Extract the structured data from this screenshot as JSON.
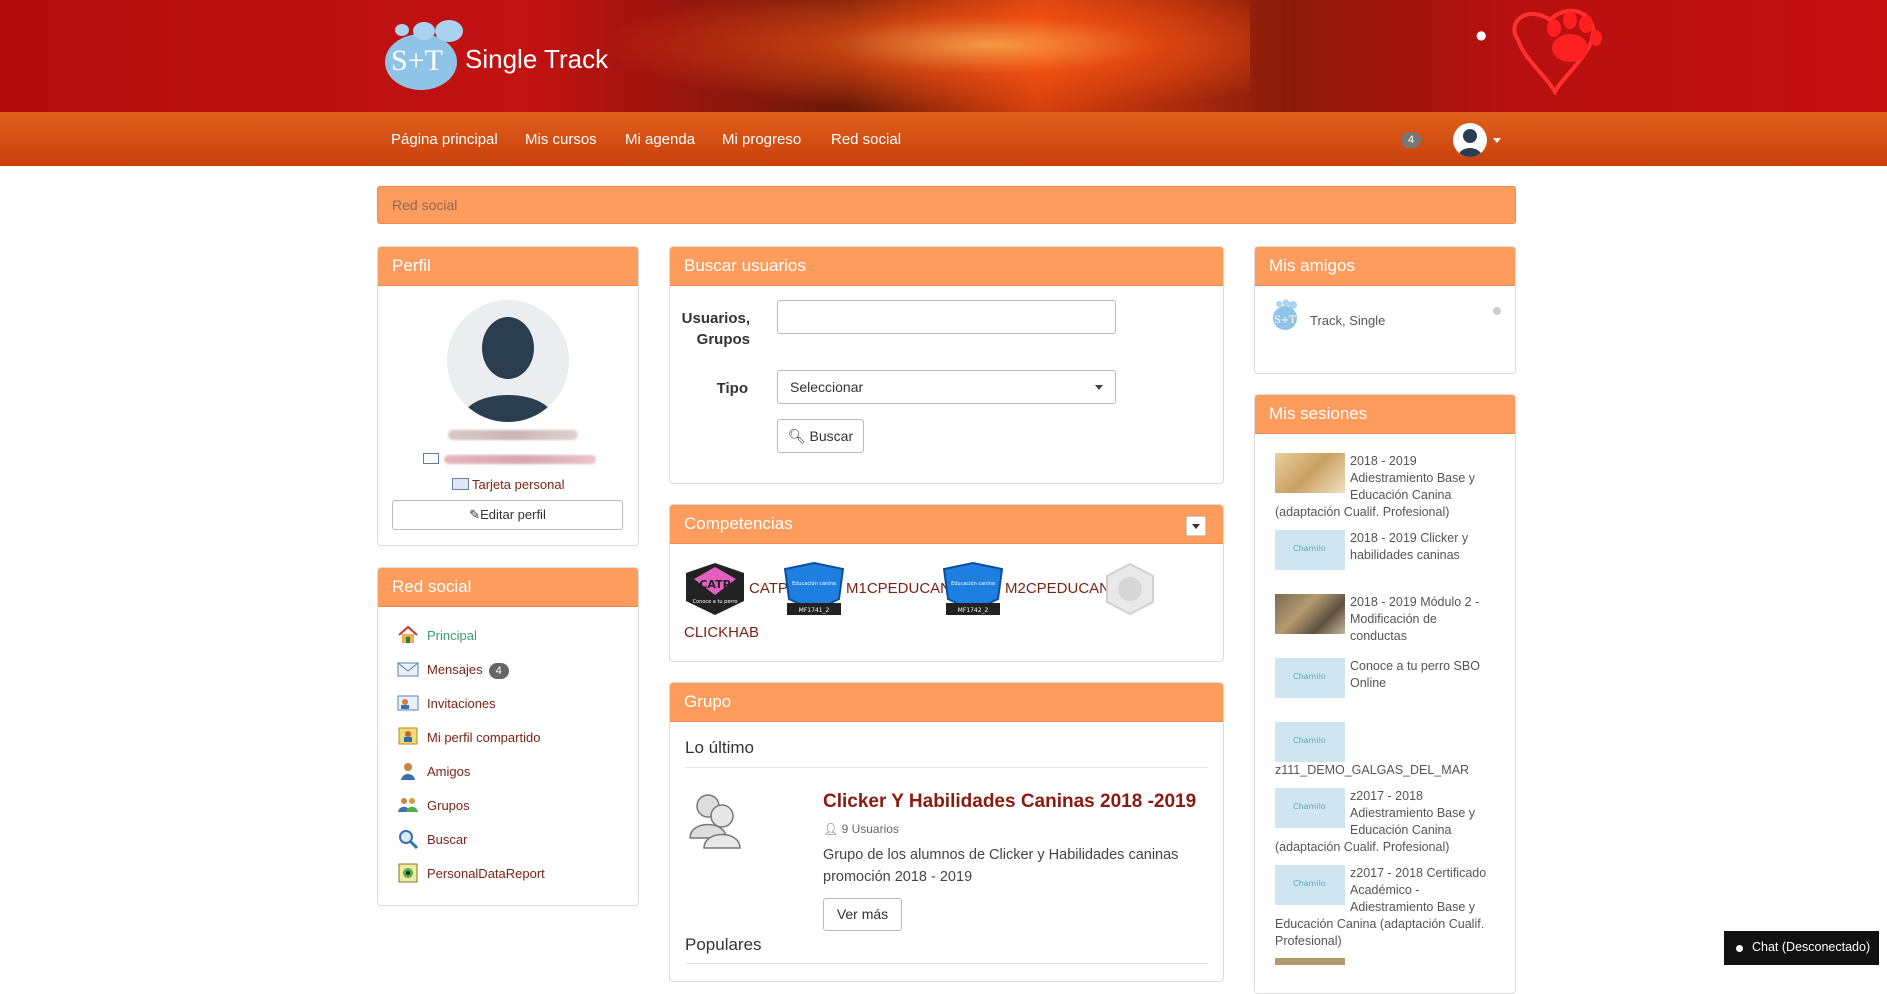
{
  "brand": {
    "name": "Single Track",
    "mark": "S+T"
  },
  "nav": {
    "items": [
      "Página principal",
      "Mis cursos",
      "Mi agenda",
      "Mi progreso",
      "Red social"
    ],
    "notifications": "4"
  },
  "breadcrumb": {
    "current": "Red social"
  },
  "profile": {
    "title": "Perfil",
    "card_link": "Tarjeta personal",
    "edit_button": "Editar perfil"
  },
  "social": {
    "title": "Red social",
    "items": [
      {
        "label": "Principal",
        "icon": "home-icon"
      },
      {
        "label": "Mensajes",
        "icon": "envelope-icon",
        "badge": "4"
      },
      {
        "label": "Invitaciones",
        "icon": "invitation-icon"
      },
      {
        "label": "Mi perfil compartido",
        "icon": "shared-profile-icon"
      },
      {
        "label": "Amigos",
        "icon": "friends-icon"
      },
      {
        "label": "Grupos",
        "icon": "groups-icon"
      },
      {
        "label": "Buscar",
        "icon": "magnifier-icon"
      },
      {
        "label": "PersonalDataReport",
        "icon": "report-icon"
      }
    ]
  },
  "search": {
    "title": "Buscar usuarios",
    "users_label_1": "Usuarios,",
    "users_label_2": "Grupos",
    "type_label": "Tipo",
    "type_value": "Seleccionar",
    "button": "Buscar"
  },
  "competencies": {
    "title": "Competencias",
    "items": [
      {
        "code": "CATP",
        "badge_text": "CATP",
        "badge_sub": "Conoce a tu perro"
      },
      {
        "code": "M1CPEDUCAN",
        "badge_text": "Educación canina",
        "badge_sub": "MF1741_2"
      },
      {
        "code": "M2CPEDUCAN",
        "badge_text": "Educación canina",
        "badge_sub": "MF1742_2"
      },
      {
        "code": "CLICKHAB"
      }
    ]
  },
  "group": {
    "title": "Grupo",
    "latest": "Lo último",
    "name": "Clicker Y Habilidades Caninas 2018 -2019",
    "members": "9 Usuarios",
    "description": "Grupo de los alumnos de Clicker y Habilidades caninas promoción 2018 - 2019",
    "more_button": "Ver más",
    "popular": "Populares"
  },
  "friends": {
    "title": "Mis amigos",
    "items": [
      {
        "name": "Track, Single"
      }
    ]
  },
  "sessions": {
    "title": "Mis sesiones",
    "thumb_logo_text": "Chamilo",
    "items": [
      {
        "lines": [
          "2018 - 2019",
          "Adiestramiento Base y",
          "Educación Canina",
          "(adaptación Cualif. Profesional)"
        ],
        "thumb": "dog-photo"
      },
      {
        "lines": [
          "2018 - 2019 Clicker y",
          "habilidades caninas"
        ],
        "thumb": "chamilo-logo"
      },
      {
        "lines": [
          "2018 - 2019 Módulo 2 -",
          "Modificación de",
          "conductas"
        ],
        "thumb": "dogs-photo"
      },
      {
        "lines": [
          "Conoce a tu perro SBO",
          "Online"
        ],
        "thumb": "chamilo-logo"
      },
      {
        "lines": [
          "z111_DEMO_GALGAS_DEL_MAR"
        ],
        "thumb": "chamilo-logo"
      },
      {
        "lines": [
          "z2017 - 2018",
          "Adiestramiento Base y",
          "Educación Canina",
          "(adaptación Cualif. Profesional)"
        ],
        "thumb": "chamilo-logo"
      },
      {
        "lines": [
          "z2017 - 2018 Certificado",
          "Académico -",
          "Adiestramiento Base y",
          "Educación Canina (adaptación Cualif.",
          "Profesional)"
        ],
        "thumb": "chamilo-logo"
      }
    ]
  },
  "chat": {
    "label": "Chat (Desconectado)"
  },
  "colors": {
    "brand_red": "#c21212",
    "nav_orange": "#d9531a",
    "panel_orange": "#fe9c5e",
    "link": "#7a2416",
    "active_link": "#3c9b72"
  }
}
